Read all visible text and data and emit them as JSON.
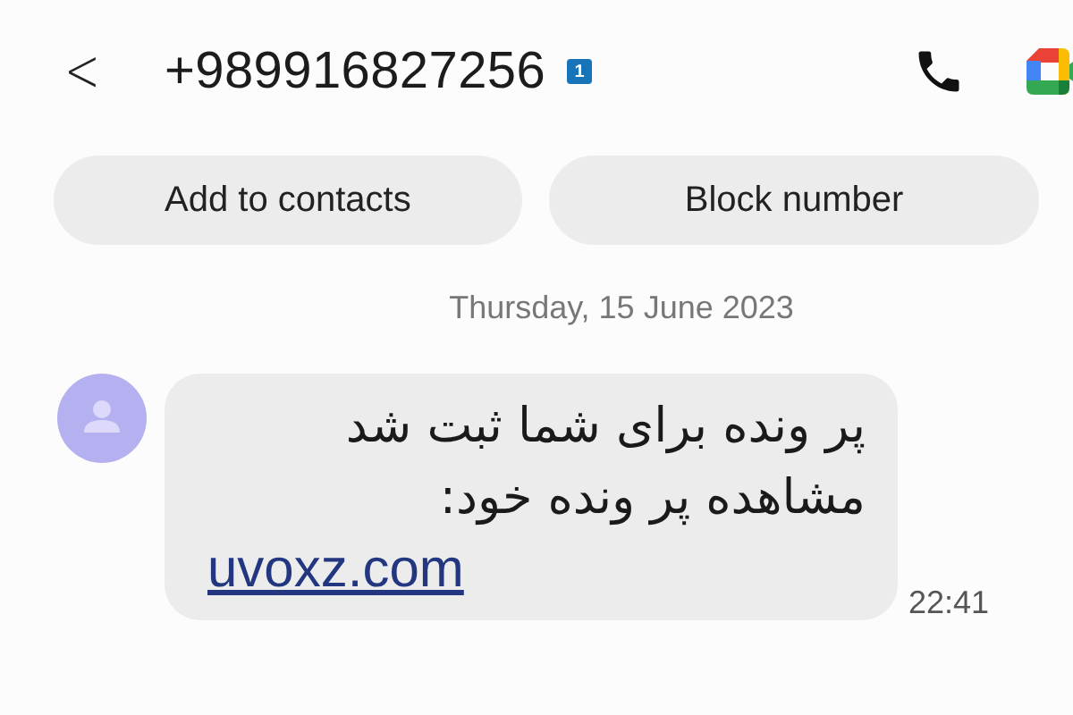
{
  "header": {
    "back": "<",
    "number": "+989916827256",
    "sim_badge": "1"
  },
  "actions": [
    {
      "label": "Add to contacts"
    },
    {
      "label": "Block number"
    }
  ],
  "date": "Thursday, 15 June 2023",
  "message": {
    "lines": [
      "پر ونده برای شما ثبت شد",
      "مشاهده پر ونده خود:"
    ],
    "link": "uvoxz.com",
    "time": "22:41"
  }
}
